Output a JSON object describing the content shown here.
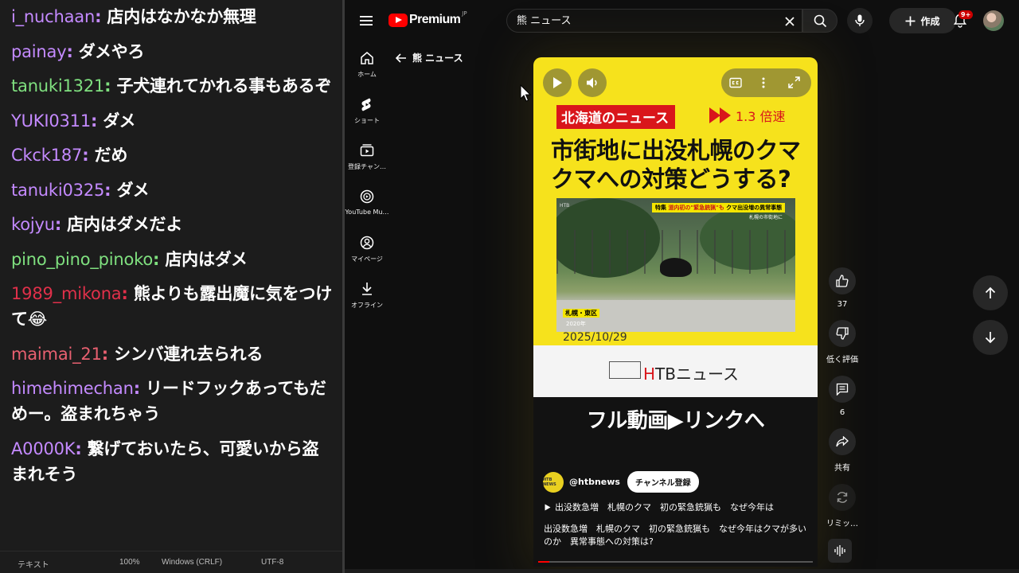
{
  "chat": {
    "messages": [
      {
        "user": "i_nuchaan",
        "color": "#c48aff",
        "text": "店内はなかなか無理"
      },
      {
        "user": "painay",
        "color": "#c48aff",
        "text": "ダメやろ"
      },
      {
        "user": "tanuki1321",
        "color": "#7fe07f",
        "text": "子犬連れてかれる事もあるぞ"
      },
      {
        "user": "YUKI0311",
        "color": "#c48aff",
        "text": "ダメ"
      },
      {
        "user": "Ckck187",
        "color": "#c48aff",
        "text": "だめ"
      },
      {
        "user": "tanuki0325",
        "color": "#c48aff",
        "text": "ダメ"
      },
      {
        "user": "kojyu",
        "color": "#c48aff",
        "text": "店内はダメだよ"
      },
      {
        "user": "pino_pino_pinoko",
        "color": "#7fe07f",
        "text": "店内はダメ"
      },
      {
        "user": "1989_mikona",
        "color": "#e0304a",
        "text": "熊よりも露出魔に気をつけて😂"
      },
      {
        "user": "maimai_21",
        "color": "#e86070",
        "text": "シンバ連れ去られる"
      },
      {
        "user": "himehimechan",
        "color": "#c48aff",
        "text": "リードフックあってもだめー。盗まれちゃう"
      },
      {
        "user": "A0000K",
        "color": "#c48aff",
        "text": "繋げておいたら、可愛いから盗まれそう"
      }
    ],
    "separator": ":",
    "status": {
      "mode": "テキスト",
      "zoom": "100%",
      "line_ending": "Windows (CRLF)",
      "encoding": "UTF-8"
    }
  },
  "youtube": {
    "logo": {
      "word": "Premium",
      "region": "JP"
    },
    "search": {
      "value": "熊 ニュース"
    },
    "create_label": "作成",
    "notifications_badge": "9+",
    "nav": [
      {
        "label": "ホーム",
        "icon": "home-icon"
      },
      {
        "label": "ショート",
        "icon": "shorts-icon"
      },
      {
        "label": "登録チャン…",
        "icon": "subscriptions-icon"
      },
      {
        "label": "YouTube Mu…",
        "icon": "music-icon"
      },
      {
        "label": "マイページ",
        "icon": "profile-icon"
      },
      {
        "label": "オフライン",
        "icon": "download-icon"
      }
    ],
    "back_label": "熊 ニュース",
    "short": {
      "news_tag": "北海道のニュース",
      "speed": "1.3 倍速",
      "headline_line1": "市街地に出没札幌のクマ",
      "headline_line2": "クマへの対策どうする?",
      "photo_caption_prefix": "特集",
      "photo_caption_red": "道内初の\"緊急銃猟\"も",
      "photo_caption_rest": "クマ出没増の異常事態",
      "photo_sub": "札幌の市街地に",
      "photo_location": "札幌・東区",
      "photo_year": "2020年",
      "photo_logo": "HTB",
      "date": "2025/10/29",
      "htb_h": "H",
      "htb_rest": "TBニュース",
      "overlay_title": "フル動画▶リンクへ",
      "channel_name": "@htbnews",
      "channel_logo_text": "HTB NEWS",
      "subscribe_label": "チャンネル登録",
      "desc_line1": "出没数急増　札幌のクマ　初の緊急銃猟も　なぜ今年は",
      "desc_line2": "出没数急増　札幌のクマ　初の緊急銃猟も　なぜ今年はクマが多いのか　異常事態への対策は?",
      "progress": 0.04
    },
    "actions": {
      "like_count": "37",
      "dislike_label": "低く評価",
      "comment_count": "6",
      "share_label": "共有",
      "remix_label": "リミッ…"
    },
    "accent_color": "#ff0000"
  }
}
